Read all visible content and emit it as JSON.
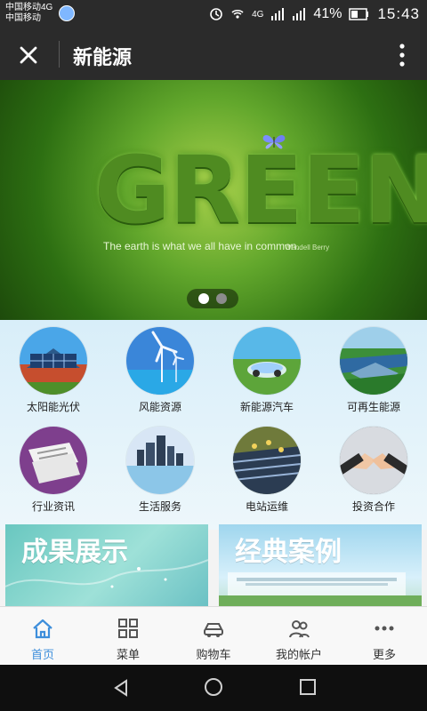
{
  "status": {
    "carrier_1": "中国移动4G",
    "carrier_2": "中国移动",
    "network_4g": "4G",
    "battery_percent": "41%",
    "time": "15:43"
  },
  "appbar": {
    "title": "新能源"
  },
  "banner": {
    "headline": "GREEN",
    "quote": "The earth is what we all have in common.",
    "author": "Wendell Berry",
    "page_index": 1,
    "page_count": 2
  },
  "categories": [
    {
      "label": "太阳能光伏",
      "icon": "solar-panel-icon"
    },
    {
      "label": "风能资源",
      "icon": "wind-turbine-icon"
    },
    {
      "label": "新能源汽车",
      "icon": "ev-car-icon"
    },
    {
      "label": "可再生能源",
      "icon": "renewable-field-icon"
    },
    {
      "label": "行业资讯",
      "icon": "newspaper-icon"
    },
    {
      "label": "生活服务",
      "icon": "city-icon"
    },
    {
      "label": "电站运维",
      "icon": "solar-farm-icon"
    },
    {
      "label": "投资合作",
      "icon": "handshake-icon"
    }
  ],
  "promos": [
    {
      "label": "成果展示"
    },
    {
      "label": "经典案例"
    }
  ],
  "tabs": [
    {
      "label": "首页",
      "icon": "home-icon",
      "active": true
    },
    {
      "label": "菜单",
      "icon": "grid-menu-icon",
      "active": false
    },
    {
      "label": "购物车",
      "icon": "car-icon",
      "active": false
    },
    {
      "label": "我的帐户",
      "icon": "users-icon",
      "active": false
    },
    {
      "label": "更多",
      "icon": "more-dots-icon",
      "active": false
    }
  ],
  "colors": {
    "header_bg": "#2b2b2b",
    "accent": "#3d8edb",
    "tabbar_bg": "#f8f8f8",
    "nav_bg": "#0f0f0f"
  }
}
